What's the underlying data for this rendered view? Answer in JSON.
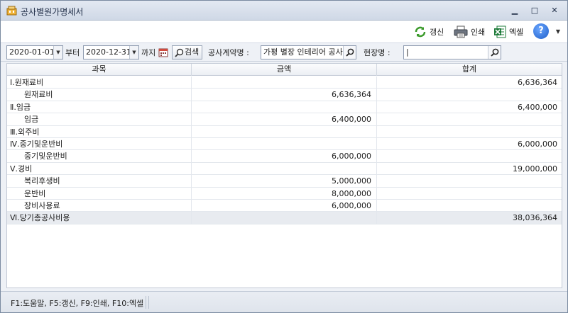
{
  "window": {
    "title": "공사별원가명세서",
    "minimize": "▁",
    "maximize": "□",
    "close": "✕"
  },
  "toolbar": {
    "refresh_label": "갱신",
    "print_label": "인쇄",
    "excel_label": "엑셀",
    "help_label": "?"
  },
  "filter": {
    "date_from": "2020-01-01",
    "from_suffix": "부터",
    "date_to": "2020-12-31",
    "to_suffix": "까지",
    "search_label": "검색",
    "contract_label": "공사계약명 :",
    "contract_value": "가평 별장 인테리어 공사",
    "site_label": "현장명 :",
    "site_value": "|"
  },
  "grid": {
    "columns": [
      "과목",
      "금액",
      "합계"
    ],
    "rows": [
      {
        "name": "Ⅰ.원재료비",
        "amount": "",
        "total": "6,636,364",
        "level": 0
      },
      {
        "name": "원재료비",
        "amount": "6,636,364",
        "total": "",
        "level": 1
      },
      {
        "name": "Ⅱ.임금",
        "amount": "",
        "total": "6,400,000",
        "level": 0
      },
      {
        "name": "임금",
        "amount": "6,400,000",
        "total": "",
        "level": 1
      },
      {
        "name": "Ⅲ.외주비",
        "amount": "",
        "total": "",
        "level": 0
      },
      {
        "name": "Ⅳ.중기및운반비",
        "amount": "",
        "total": "6,000,000",
        "level": 0
      },
      {
        "name": "중기및운반비",
        "amount": "6,000,000",
        "total": "",
        "level": 1
      },
      {
        "name": "Ⅴ.경비",
        "amount": "",
        "total": "19,000,000",
        "level": 0
      },
      {
        "name": "복리후생비",
        "amount": "5,000,000",
        "total": "",
        "level": 1
      },
      {
        "name": "운반비",
        "amount": "8,000,000",
        "total": "",
        "level": 1
      },
      {
        "name": "장비사용료",
        "amount": "6,000,000",
        "total": "",
        "level": 1
      },
      {
        "name": "Ⅵ.당기총공사비용",
        "amount": "",
        "total": "38,036,364",
        "level": 0,
        "total_row": true
      }
    ]
  },
  "statusbar": {
    "shortcuts": "F1:도움말, F5:갱신, F9:인쇄, F10:엑셀"
  },
  "colors": {
    "accent": "#1f5fc9",
    "refresh_green": "#3a9a2a",
    "excel_green": "#1e7b3a"
  }
}
